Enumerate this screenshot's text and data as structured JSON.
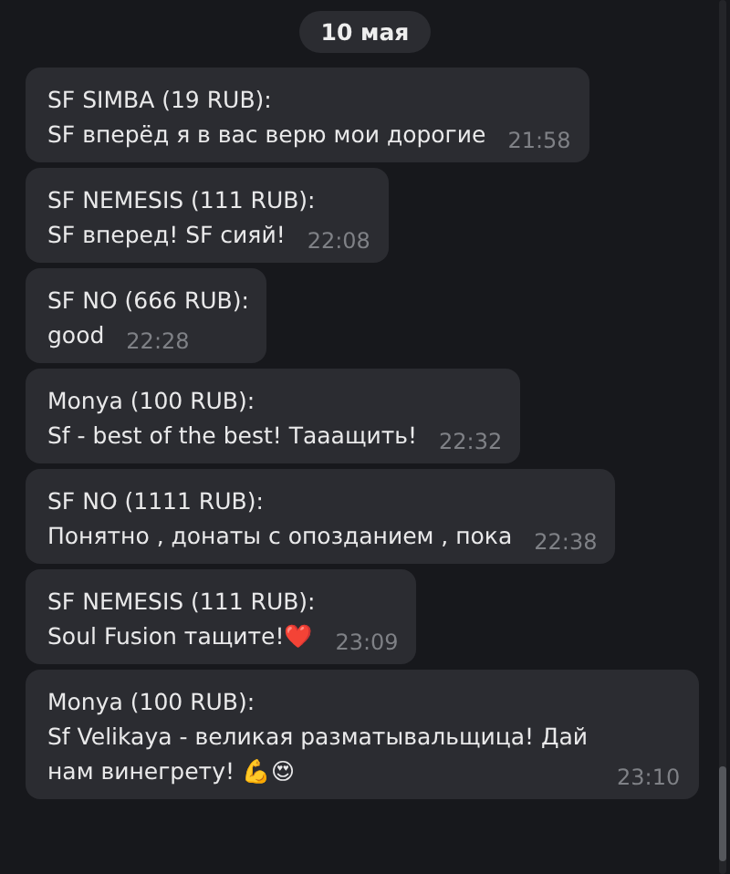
{
  "date_badge": "10 мая",
  "messages": [
    {
      "sender": "SF SIMBA  (19 RUB):",
      "text": "SF вперёд я в вас верю мои дорогие",
      "time": "21:58"
    },
    {
      "sender": "SF NEMESIS (111 RUB):",
      "text": "SF вперед! SF сияй!",
      "time": "22:08"
    },
    {
      "sender": "SF NO (666 RUB):",
      "text": "good",
      "time": "22:28"
    },
    {
      "sender": "Monya (100 RUB):",
      "text": "Sf - best of the best! Тааащить!",
      "time": "22:32"
    },
    {
      "sender": "SF NO (1111 RUB):",
      "text": "Понятно , донаты с опозданием , пока",
      "time": "22:38"
    },
    {
      "sender": "SF NEMESIS (111 RUB):",
      "text": "Soul Fusion тащите!❤️",
      "time": "23:09"
    },
    {
      "sender": "Monya (100 RUB):",
      "text": "Sf Velikaya - великая разматывальщица! Дай нам винегрету! 💪😍",
      "time": "23:10"
    }
  ]
}
